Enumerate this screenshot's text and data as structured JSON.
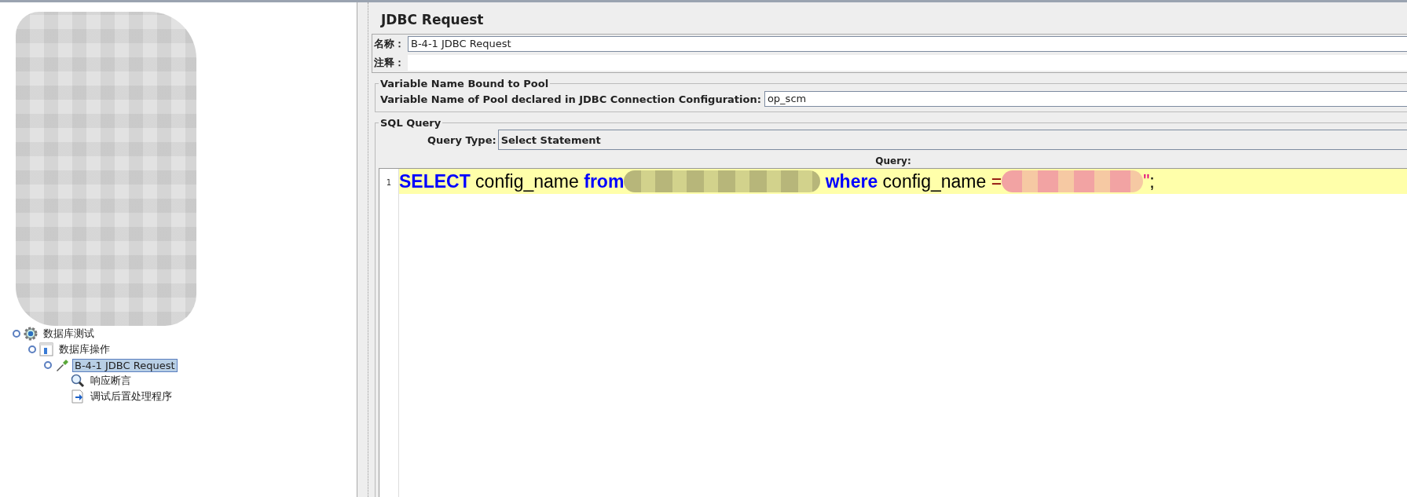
{
  "tree": {
    "items": [
      {
        "label": "数据库测试",
        "kind": "test-plan",
        "selected": false,
        "children": [
          {
            "label": "数据库操作",
            "kind": "thread-group",
            "selected": false,
            "children": [
              {
                "label": "B-4-1 JDBC Request",
                "kind": "sampler",
                "selected": true,
                "children": [
                  {
                    "label": "响应断言",
                    "kind": "assertion",
                    "selected": false
                  },
                  {
                    "label": "调试后置处理程序",
                    "kind": "post-processor",
                    "selected": false
                  }
                ]
              }
            ]
          }
        ]
      }
    ]
  },
  "panel": {
    "title": "JDBC Request",
    "name_label": "名称：",
    "name_value": "B-4-1 JDBC Request",
    "comment_label": "注释：",
    "pool_section": {
      "legend": "Variable Name Bound to Pool",
      "label": "Variable Name of Pool declared in JDBC Connection Configuration:",
      "value": "op_scm"
    },
    "sql_section": {
      "legend": "SQL Query",
      "query_type_label": "Query Type:",
      "query_type": "Select Statement",
      "query_label": "Query:",
      "lines": [
        {
          "number": "1",
          "tokens": [
            {
              "kind": "keyword",
              "text": "SELECT"
            },
            {
              "kind": "plain",
              "text": " config_name "
            },
            {
              "kind": "keyword",
              "text": "from"
            },
            {
              "kind": "redacted"
            },
            {
              "kind": "keyword",
              "text": " where"
            },
            {
              "kind": "plain",
              "text": " config_name "
            },
            {
              "kind": "operator",
              "text": "="
            },
            {
              "kind": "redacted-pink"
            },
            {
              "kind": "string",
              "text": "\""
            },
            {
              "kind": "plain",
              "text": ";"
            }
          ]
        }
      ]
    }
  }
}
